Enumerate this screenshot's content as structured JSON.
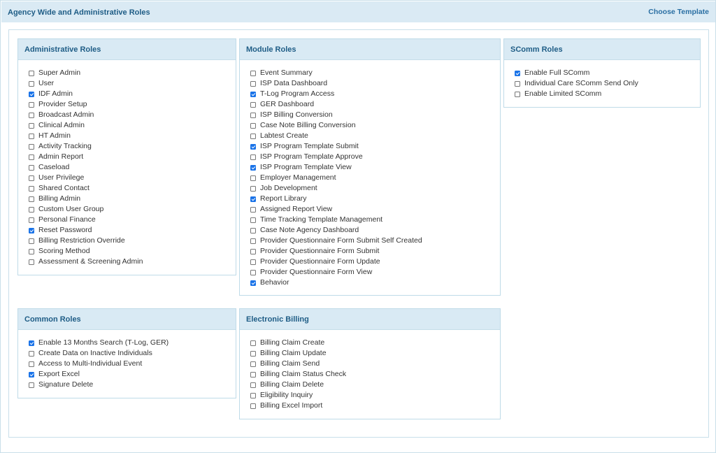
{
  "header": {
    "title": "Agency Wide and Administrative Roles",
    "choose_template": "Choose Template"
  },
  "panels": {
    "admin": {
      "title": "Administrative Roles",
      "items": [
        {
          "label": "Super Admin",
          "checked": false
        },
        {
          "label": "User",
          "checked": false
        },
        {
          "label": "IDF Admin",
          "checked": true
        },
        {
          "label": "Provider Setup",
          "checked": false
        },
        {
          "label": "Broadcast Admin",
          "checked": false
        },
        {
          "label": "Clinical Admin",
          "checked": false
        },
        {
          "label": "HT Admin",
          "checked": false
        },
        {
          "label": "Activity Tracking",
          "checked": false
        },
        {
          "label": "Admin Report",
          "checked": false
        },
        {
          "label": "Caseload",
          "checked": false
        },
        {
          "label": "User Privilege",
          "checked": false
        },
        {
          "label": "Shared Contact",
          "checked": false
        },
        {
          "label": "Billing Admin",
          "checked": false
        },
        {
          "label": "Custom User Group",
          "checked": false
        },
        {
          "label": "Personal Finance",
          "checked": false
        },
        {
          "label": "Reset Password",
          "checked": true
        },
        {
          "label": "Billing Restriction Override",
          "checked": false
        },
        {
          "label": "Scoring Method",
          "checked": false
        },
        {
          "label": "Assessment & Screening Admin",
          "checked": false
        }
      ]
    },
    "module": {
      "title": "Module Roles",
      "items": [
        {
          "label": "Event Summary",
          "checked": false
        },
        {
          "label": "ISP Data Dashboard",
          "checked": false
        },
        {
          "label": "T-Log Program Access",
          "checked": true
        },
        {
          "label": "GER Dashboard",
          "checked": false
        },
        {
          "label": "ISP Billing Conversion",
          "checked": false
        },
        {
          "label": "Case Note Billing Conversion",
          "checked": false
        },
        {
          "label": "Labtest Create",
          "checked": false
        },
        {
          "label": "ISP Program Template Submit",
          "checked": true
        },
        {
          "label": "ISP Program Template Approve",
          "checked": false
        },
        {
          "label": "ISP Program Template View",
          "checked": true
        },
        {
          "label": "Employer Management",
          "checked": false
        },
        {
          "label": "Job Development",
          "checked": false
        },
        {
          "label": "Report Library",
          "checked": true
        },
        {
          "label": "Assigned Report View",
          "checked": false
        },
        {
          "label": "Time Tracking Template Management",
          "checked": false
        },
        {
          "label": "Case Note Agency Dashboard",
          "checked": false
        },
        {
          "label": "Provider Questionnaire Form Submit Self Created",
          "checked": false
        },
        {
          "label": "Provider Questionnaire Form Submit",
          "checked": false
        },
        {
          "label": "Provider Questionnaire Form Update",
          "checked": false
        },
        {
          "label": "Provider Questionnaire Form View",
          "checked": false
        },
        {
          "label": "Behavior",
          "checked": true
        }
      ]
    },
    "scomm": {
      "title": "SComm Roles",
      "items": [
        {
          "label": "Enable Full SComm",
          "checked": true
        },
        {
          "label": "Individual Care SComm Send Only",
          "checked": false
        },
        {
          "label": "Enable Limited SComm",
          "checked": false
        }
      ]
    },
    "common": {
      "title": "Common Roles",
      "items": [
        {
          "label": "Enable 13 Months Search (T-Log, GER)",
          "checked": true
        },
        {
          "label": "Create Data on Inactive Individuals",
          "checked": false
        },
        {
          "label": "Access to Multi-Individual Event",
          "checked": false
        },
        {
          "label": "Export Excel",
          "checked": true
        },
        {
          "label": "Signature Delete",
          "checked": false
        }
      ]
    },
    "billing": {
      "title": "Electronic Billing",
      "items": [
        {
          "label": "Billing Claim Create",
          "checked": false
        },
        {
          "label": "Billing Claim Update",
          "checked": false
        },
        {
          "label": "Billing Claim Send",
          "checked": false
        },
        {
          "label": "Billing Claim Status Check",
          "checked": false
        },
        {
          "label": "Billing Claim Delete",
          "checked": false
        },
        {
          "label": "Eligibility Inquiry",
          "checked": false
        },
        {
          "label": "Billing Excel Import",
          "checked": false
        }
      ]
    }
  }
}
